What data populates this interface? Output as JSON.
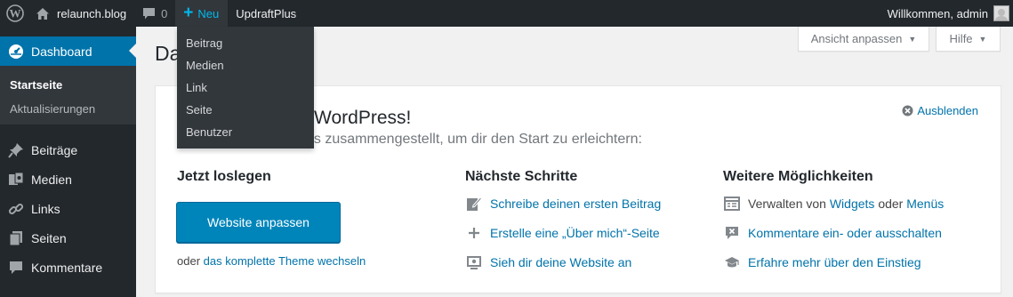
{
  "adminbar": {
    "site_name": "relaunch.blog",
    "comments_count": "0",
    "new_label": "Neu",
    "updraft_label": "UpdraftPlus",
    "greeting": "Willkommen, admin"
  },
  "new_menu": {
    "items": [
      "Beitrag",
      "Medien",
      "Link",
      "Seite",
      "Benutzer"
    ]
  },
  "sidebar": {
    "dashboard_label": "Dashboard",
    "submenu": [
      "Startseite",
      "Aktualisierungen"
    ],
    "items": [
      {
        "label": "Beiträge",
        "icon": "pin-icon"
      },
      {
        "label": "Medien",
        "icon": "media-icon"
      },
      {
        "label": "Links",
        "icon": "links-icon"
      },
      {
        "label": "Seiten",
        "icon": "pages-icon"
      },
      {
        "label": "Kommentare",
        "icon": "comments-icon"
      }
    ]
  },
  "page": {
    "title": "Dashboard",
    "screen_options": "Ansicht anpassen",
    "help": "Hilfe"
  },
  "welcome": {
    "title": "Willkommen bei WordPress!",
    "about": "Wir haben einige Links zusammengestellt, um dir den Start zu erleichtern:",
    "dismiss": "Ausblenden",
    "col1_heading": "Jetzt loslegen",
    "cta": "Website anpassen",
    "alt_prefix": "oder",
    "alt_link": "das komplette Theme wechseln",
    "col2_heading": "Nächste Schritte",
    "next_steps": [
      "Schreibe deinen ersten Beitrag",
      "Erstelle eine „Über mich“-Seite",
      "Sieh dir deine Website an"
    ],
    "col3_heading": "Weitere Möglichkeiten",
    "more1_prefix": "Verwalten von",
    "more1_link_a": "Widgets",
    "more1_mid": "oder",
    "more1_link_b": "Menüs",
    "more2": "Kommentare ein- oder ausschalten",
    "more3": "Erfahre mehr über den Einstieg"
  },
  "colors": {
    "adminbar": "#23282d",
    "accent": "#0073aa",
    "primary_button": "#0085ba",
    "new_highlight": "#00b9eb",
    "background": "#f1f1f1"
  }
}
